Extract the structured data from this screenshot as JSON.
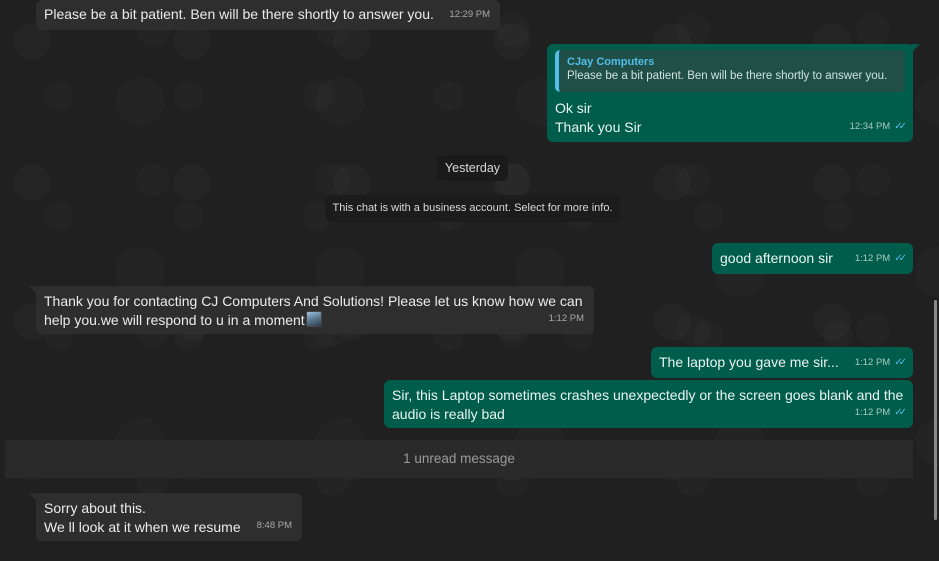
{
  "messages": [
    {
      "id": "m1",
      "direction": "in",
      "lines": [
        "Please be a bit patient. Ben will be there shortly to answer you."
      ],
      "time": "12:29 PM"
    },
    {
      "id": "m2",
      "direction": "out",
      "quote": {
        "author": "CJay Computers",
        "text": "Please be a bit patient. Ben will be there shortly to answer you."
      },
      "lines": [
        "Ok sir",
        "Thank you Sir"
      ],
      "time": "12:34 PM",
      "status": "read"
    },
    {
      "id": "m3",
      "direction": "out",
      "lines": [
        "good afternoon sir"
      ],
      "time": "1:12 PM",
      "status": "read"
    },
    {
      "id": "m4",
      "direction": "in",
      "lines": [
        "Thank you for contacting CJ Computers And Solutions! Please let us know how we can",
        "help you.we will respond to u in a moment"
      ],
      "time": "1:12 PM",
      "emoji": "image-emoji"
    },
    {
      "id": "m5",
      "direction": "out",
      "lines": [
        "The laptop you gave me sir..."
      ],
      "time": "1:12 PM",
      "status": "read"
    },
    {
      "id": "m6",
      "direction": "out",
      "lines": [
        "Sir, this Laptop sometimes crashes unexpectedly or the screen goes blank and the",
        "audio is really bad"
      ],
      "time": "1:12 PM",
      "status": "read"
    },
    {
      "id": "m7",
      "direction": "in",
      "lines": [
        "Sorry about this.",
        "We ll look at it when we resume"
      ],
      "time": "8:48 PM"
    }
  ],
  "date_chip": "Yesterday",
  "system_notice": "This chat is with a business account. Select for more info.",
  "unread_banner": "1 unread message",
  "ticks": "✓✓",
  "colors": {
    "background": "#202020",
    "incoming": "#2e2e2e",
    "outgoing": "#005c4b",
    "tick": "#53bdeb"
  }
}
